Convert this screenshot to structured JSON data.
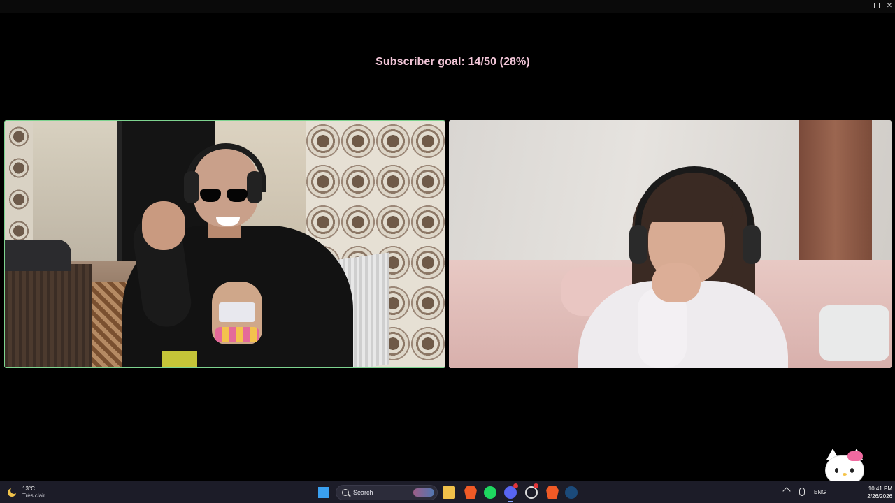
{
  "window": {
    "controls": [
      "minimize",
      "maximize",
      "close"
    ]
  },
  "goal_text": "Subscriber goal: 14/50 (28%)",
  "goal": {
    "current": 14,
    "target": 50,
    "percent": 28
  },
  "participants": [
    {
      "position": "left",
      "speaking": true,
      "highlight_color": "#7dd38f"
    },
    {
      "position": "right",
      "speaking": false
    }
  ],
  "taskbar": {
    "weather": {
      "temp": "13°C",
      "desc": "Très clair",
      "icon": "moon-icon"
    },
    "search_label": "Search",
    "apps": [
      {
        "name": "file-explorer",
        "icon": "folder-icon"
      },
      {
        "name": "brave-browser",
        "icon": "brave-icon"
      },
      {
        "name": "spotify",
        "icon": "spotify-icon"
      },
      {
        "name": "discord",
        "icon": "discord-icon",
        "active": true
      },
      {
        "name": "app",
        "icon": "ring-icon"
      },
      {
        "name": "brave-browser-2",
        "icon": "brave-icon"
      },
      {
        "name": "steam",
        "icon": "steam-icon"
      }
    ],
    "tray": {
      "language": "ENG"
    },
    "clock": {
      "time": "10:41 PM",
      "date": "2/26/2026"
    }
  },
  "colors": {
    "goal_text": "#f2c6d8",
    "speaker_border": "#7dd38f",
    "taskbar_bg": "#1c1c28"
  }
}
